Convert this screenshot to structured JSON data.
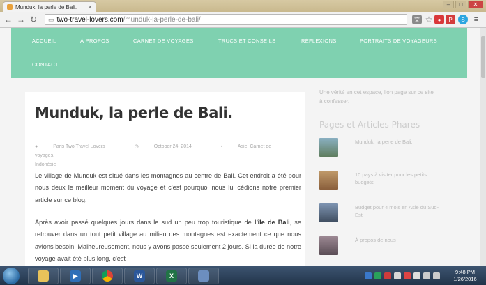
{
  "browser": {
    "tab_title": "Munduk, la perle de Bali.",
    "tab_close": "×",
    "url_domain": "two-travel-lovers.com",
    "url_path": "/munduk-la-perle-de-bali/"
  },
  "nav": {
    "items": [
      "ACCUEIL",
      "À PROPOS",
      "CARNET DE VOYAGES",
      "TRUCS ET CONSEILS",
      "RÉFLEXIONS",
      "PORTRAITS DE VOYAGEURS"
    ],
    "second_row": [
      "CONTACT"
    ]
  },
  "article": {
    "title": "Munduk, la perle de Bali.",
    "meta_author": "Paris Two Travel Lovers",
    "meta_date": "October 24, 2014",
    "meta_category": "Asie, Carnet de voyages,",
    "meta_category2": "Indonésie",
    "para1": "Le village de Munduk est situé dans les montagnes au centre de Bali. Cet endroit a été pour nous deux le meilleur moment du voyage et c'est pourquoi nous lui cédions notre premier article sur ce blog.",
    "para2_start": "Après avoir passé quelques jours dans le sud un peu trop touristique de ",
    "para2_bold": "l'île de Bali",
    "para2_end": ", se retrouver dans un tout petit village au milieu des montagnes est exactement ce que nous avions besoin. Malheureusement, nous y avons passé seulement 2 jours. Si la durée de notre voyage avait été plus long, c'est"
  },
  "sidebar": {
    "intro": "Une vérité en cet espace, l'on page sur ce site à confesser.",
    "section_title": "Pages et Articles Phares",
    "posts": [
      {
        "label": "Munduk, la perle de Bali.",
        "color": "#6d8f7a"
      },
      {
        "label": "10 pays à visiter pour les petits budgets",
        "color": "#a57a55"
      },
      {
        "label": "Budget pour 4 mois en Asie du Sud-Est",
        "color": "#5a6c82"
      },
      {
        "label": "À propos de nous",
        "color": "#7a6d74"
      }
    ]
  },
  "taskbar": {
    "time": "9:48 PM",
    "date": "1/26/2016"
  },
  "colors": {
    "nav_bg": "#7fd1b0",
    "accent": "#7fd1b0"
  }
}
